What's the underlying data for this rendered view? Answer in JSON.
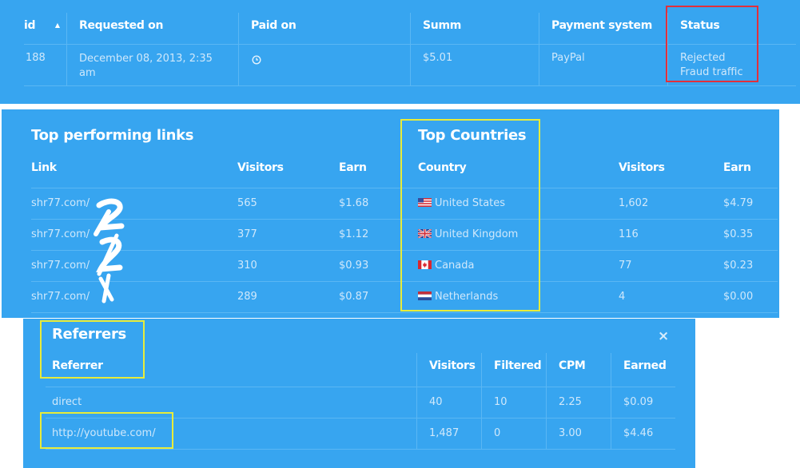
{
  "payments": {
    "headers": {
      "id": "id",
      "requested_on": "Requested on",
      "paid_on": "Paid on",
      "summ": "Summ",
      "payment_system": "Payment system",
      "status": "Status"
    },
    "row": {
      "id": "188",
      "requested_line1": "December 08, 2013, 2:35",
      "requested_line2": "am",
      "summ": "$5.01",
      "payment_system": "PayPal",
      "status_line1": "Rejected",
      "status_line2": "Fraud traffic"
    }
  },
  "top_links": {
    "title": "Top performing links",
    "headers": {
      "link": "Link",
      "visitors": "Visitors",
      "earn": "Earn"
    },
    "rows": [
      {
        "link": "shr77.com/",
        "visitors": "565",
        "earn": "$1.68"
      },
      {
        "link": "shr77.com/",
        "visitors": "377",
        "earn": "$1.12"
      },
      {
        "link": "shr77.com/",
        "visitors": "310",
        "earn": "$0.93"
      },
      {
        "link": "shr77.com/",
        "visitors": "289",
        "earn": "$0.87"
      }
    ]
  },
  "top_countries": {
    "title": "Top Countries",
    "headers": {
      "country": "Country",
      "visitors": "Visitors",
      "earn": "Earn"
    },
    "rows": [
      {
        "country": "United States",
        "flag": "us-flag-icon",
        "visitors": "1,602",
        "earn": "$4.79"
      },
      {
        "country": "United Kingdom",
        "flag": "uk-flag-icon",
        "visitors": "116",
        "earn": "$0.35"
      },
      {
        "country": "Canada",
        "flag": "canada-flag-icon",
        "visitors": "77",
        "earn": "$0.23"
      },
      {
        "country": "Netherlands",
        "flag": "netherlands-flag-icon",
        "visitors": "4",
        "earn": "$0.00"
      }
    ]
  },
  "referrers": {
    "title": "Referrers",
    "close_glyph": "×",
    "headers": {
      "referrer": "Referrer",
      "visitors": "Visitors",
      "filtered": "Filtered",
      "cpm": "CPM",
      "earned": "Earned"
    },
    "rows": [
      {
        "referrer": "direct",
        "visitors": "40",
        "filtered": "10",
        "cpm": "2.25",
        "earned": "$0.09"
      },
      {
        "referrer": "http://youtube.com/",
        "visitors": "1,487",
        "filtered": "0",
        "cpm": "3.00",
        "earned": "$4.46"
      }
    ]
  },
  "colors": {
    "panel": "#37a5f0",
    "highlight_yellow": "#e8ec3a",
    "highlight_red": "#e2303b"
  }
}
